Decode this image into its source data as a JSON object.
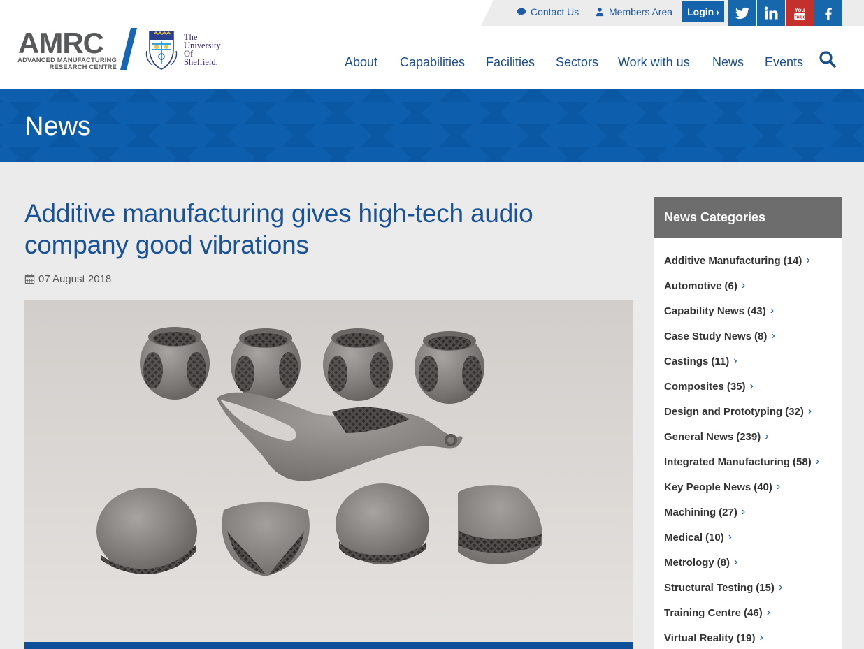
{
  "topbar": {
    "contact_label": "Contact Us",
    "members_label": "Members Area",
    "login_label": "Login",
    "social": [
      {
        "name": "twitter-icon",
        "color": "#1767ad"
      },
      {
        "name": "linkedin-icon",
        "color": "#1767ad"
      },
      {
        "name": "youtube-icon",
        "color": "#c4302b"
      },
      {
        "name": "facebook-icon",
        "color": "#1767ad"
      }
    ]
  },
  "logo": {
    "amrc": "AMRC",
    "amrc_line1": "ADVANCED MANUFACTURING",
    "amrc_line2": "RESEARCH CENTRE",
    "uni_line1": "The",
    "uni_line2": "University",
    "uni_line3": "Of",
    "uni_line4": "Sheffield."
  },
  "nav": {
    "items": [
      "About",
      "Capabilities",
      "Facilities",
      "Sectors",
      "Work with us",
      "News",
      "Events"
    ]
  },
  "banner": {
    "title": "News"
  },
  "article": {
    "title": "Additive manufacturing gives high-tech audio company good vibrations",
    "date": "07 August 2018"
  },
  "sidebar": {
    "heading": "News Categories",
    "categories": [
      {
        "label": "Additive Manufacturing",
        "count": "(14)"
      },
      {
        "label": "Automotive",
        "count": "(6)"
      },
      {
        "label": "Capability News",
        "count": "(43)"
      },
      {
        "label": "Case Study News",
        "count": "(8)"
      },
      {
        "label": "Castings",
        "count": "(11)"
      },
      {
        "label": "Composites",
        "count": "(35)"
      },
      {
        "label": "Design and Prototyping",
        "count": "(32)"
      },
      {
        "label": "General News",
        "count": "(239)"
      },
      {
        "label": "Integrated Manufacturing",
        "count": "(58)"
      },
      {
        "label": "Key People News",
        "count": "(40)"
      },
      {
        "label": "Machining",
        "count": "(27)"
      },
      {
        "label": "Medical",
        "count": "(10)"
      },
      {
        "label": "Metrology",
        "count": "(8)"
      },
      {
        "label": "Structural Testing",
        "count": "(15)"
      },
      {
        "label": "Training Centre",
        "count": "(46)"
      },
      {
        "label": "Virtual Reality",
        "count": "(19)"
      }
    ]
  },
  "colors": {
    "brand_blue": "#0a57a4",
    "nav_text": "#1b4e8d",
    "title_blue": "#1a5296",
    "sidebar_head": "#6d6d6d"
  }
}
